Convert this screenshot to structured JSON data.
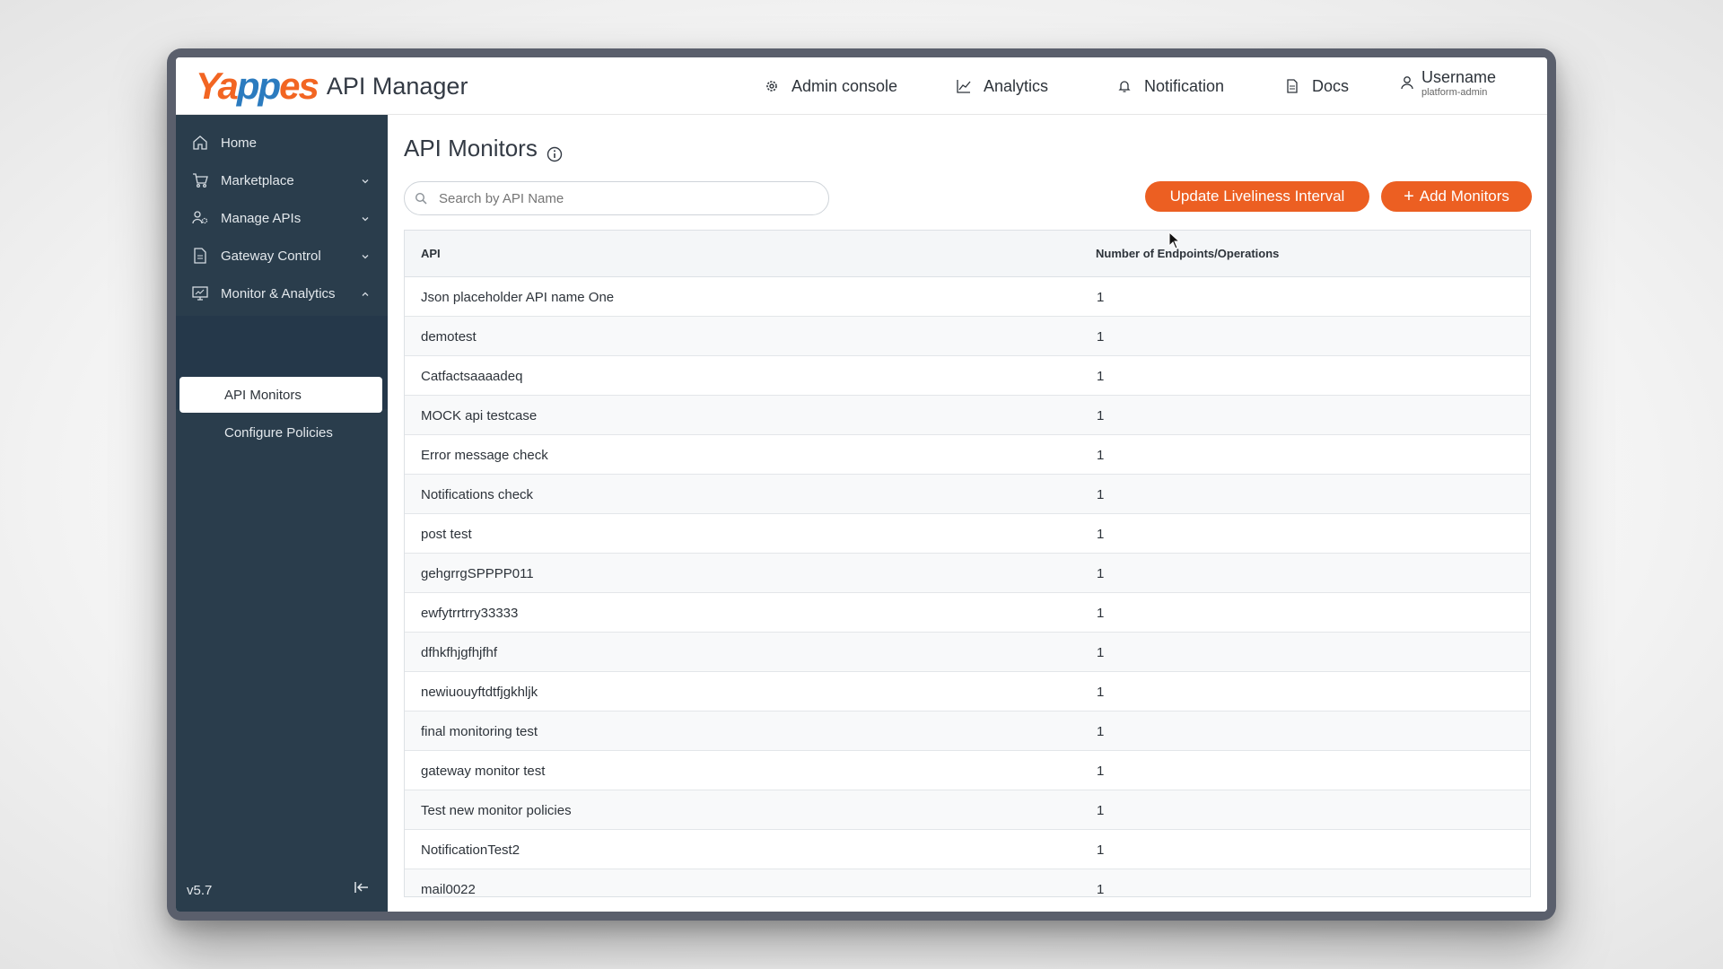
{
  "header": {
    "logo_text_a": "Ya",
    "logo_text_b": "pp",
    "logo_text_c": "es",
    "product": "API Manager",
    "nav": {
      "admin": "Admin console",
      "analytics": "Analytics",
      "notification": "Notification",
      "docs": "Docs"
    },
    "user": {
      "name": "Username",
      "role": "platform-admin"
    }
  },
  "sidebar": {
    "items": [
      {
        "label": "Home",
        "icon": "home-icon"
      },
      {
        "label": "Marketplace",
        "icon": "cart-icon"
      },
      {
        "label": "Manage APIs",
        "icon": "manage-icon"
      },
      {
        "label": "Gateway Control",
        "icon": "document-icon"
      },
      {
        "label": "Monitor & Analytics",
        "icon": "monitor-icon"
      }
    ],
    "subitems": [
      {
        "label": "API Monitors",
        "active": true
      },
      {
        "label": "Configure Policies",
        "active": false
      }
    ],
    "version": "v5.7"
  },
  "main": {
    "title": "API Monitors",
    "search_placeholder": "Search by API Name",
    "update_button": "Update Liveliness Interval",
    "add_button": "Add Monitors",
    "columns": [
      "API",
      "Number of Endpoints/Operations"
    ],
    "rows": [
      [
        "Json placeholder API name One",
        "1"
      ],
      [
        "demotest",
        "1"
      ],
      [
        "Catfactsaaaadeq",
        "1"
      ],
      [
        "MOCK api testcase",
        "1"
      ],
      [
        "Error message check",
        "1"
      ],
      [
        "Notifications check",
        "1"
      ],
      [
        "post test",
        "1"
      ],
      [
        "gehgrrgSPPPP011",
        "1"
      ],
      [
        "ewfytrrtrry33333",
        "1"
      ],
      [
        "dfhkfhjgfhjfhf",
        "1"
      ],
      [
        "newiuouyftdtfjgkhljk",
        "1"
      ],
      [
        "final monitoring test",
        "1"
      ],
      [
        "gateway monitor test",
        "1"
      ],
      [
        "Test new monitor policies",
        "1"
      ],
      [
        "NotificationTest2",
        "1"
      ],
      [
        "mail0022",
        "1"
      ]
    ]
  },
  "colors": {
    "accent": "#ec5f22",
    "sidebar": "#2a3d4c",
    "logo_orange": "#f26522",
    "logo_blue": "#2b7bbf"
  }
}
